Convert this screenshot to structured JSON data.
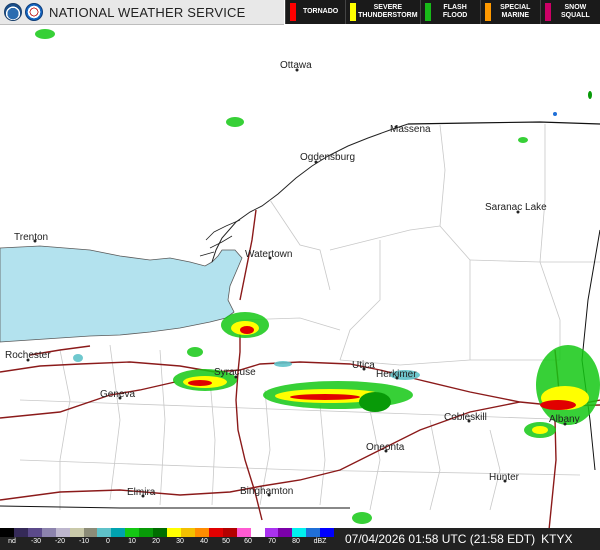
{
  "header": {
    "title": "NATIONAL WEATHER SERVICE",
    "warnings": [
      {
        "label": "TORNADO",
        "color": "#ff0000"
      },
      {
        "label": "SEVERE THUNDERSTORM",
        "color": "#ffff00"
      },
      {
        "label": "FLASH FLOOD",
        "color": "#18b918"
      },
      {
        "label": "SPECIAL MARINE",
        "color": "#ff9900"
      },
      {
        "label": "SNOW SQUALL",
        "color": "#cc0066"
      }
    ]
  },
  "map": {
    "cities": [
      {
        "name": "Ottawa"
      },
      {
        "name": "Massena"
      },
      {
        "name": "Ogdensburg"
      },
      {
        "name": "Saranac Lake"
      },
      {
        "name": "Trenton"
      },
      {
        "name": "Watertown"
      },
      {
        "name": "Rochester"
      },
      {
        "name": "Syracuse"
      },
      {
        "name": "Utica"
      },
      {
        "name": "Herkimer"
      },
      {
        "name": "Geneva"
      },
      {
        "name": "Cobleskill"
      },
      {
        "name": "Albany"
      },
      {
        "name": "Oneonta"
      },
      {
        "name": "Hunter"
      },
      {
        "name": "Elmira"
      },
      {
        "name": "Binghamton"
      }
    ]
  },
  "footer": {
    "scale_labels": [
      "nd",
      "-30",
      "-20",
      "-10",
      "0",
      "10",
      "20",
      "30",
      "40",
      "50",
      "60",
      "70",
      "80",
      "dBZ"
    ],
    "scale_colors": [
      "#000000",
      "#352a58",
      "#5b4a8a",
      "#8c83ad",
      "#bdb6cd",
      "#c9c9a9",
      "#8c8c78",
      "#5fc2c9",
      "#00a3b0",
      "#14c814",
      "#089a08",
      "#006d00",
      "#ffff00",
      "#f3c000",
      "#ff8c00",
      "#e10000",
      "#b40000",
      "#ff5ad2",
      "#ffffff",
      "#aa32f0",
      "#7a00a8",
      "#00f0f0",
      "#1f6fd7",
      "#0000ff"
    ],
    "timestamp": "07/04/2026 01:58 UTC (21:58 EDT)",
    "station": "KTYX"
  }
}
